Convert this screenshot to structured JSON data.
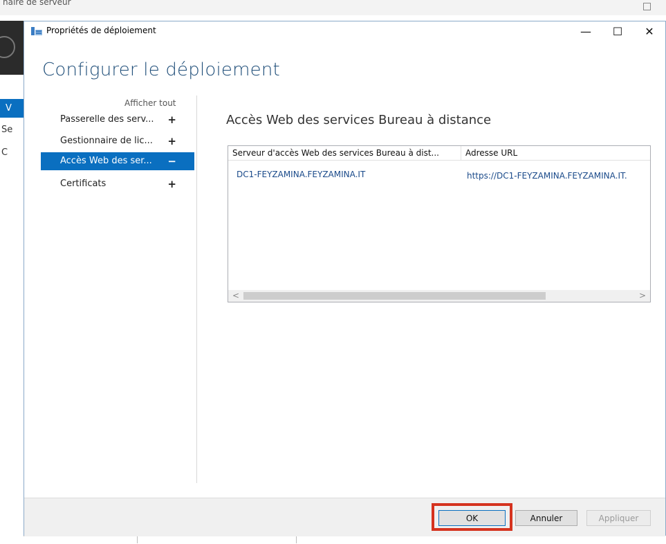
{
  "background": {
    "window_title": "naire de serveur",
    "side_selected": "V",
    "side_items": [
      "Se",
      "C"
    ]
  },
  "dialog": {
    "title": "Propriétés de déploiement",
    "window_controls": {
      "minimize": "—",
      "maximize": "☐",
      "close": "✕"
    },
    "heading": "Configurer le déploiement",
    "nav": {
      "show_all": "Afficher tout",
      "items": [
        {
          "label": "Passerelle des serv...",
          "toggle": "+"
        },
        {
          "label": "Gestionnaire de lic...",
          "toggle": "+"
        },
        {
          "label": "Accès Web des ser...",
          "toggle": "−",
          "selected": true
        },
        {
          "label": "Certificats",
          "toggle": "+"
        }
      ]
    },
    "section_title": "Accès Web des services Bureau à distance",
    "table": {
      "columns": [
        "Serveur d'accès Web des services Bureau à dist...",
        "Adresse URL"
      ],
      "rows": [
        [
          "DC1-FEYZAMINA.FEYZAMINA.IT",
          "https://DC1-FEYZAMINA.FEYZAMINA.IT."
        ]
      ],
      "scroll_left": "<",
      "scroll_right": ">"
    },
    "buttons": {
      "ok": "OK",
      "cancel": "Annuler",
      "apply": "Appliquer"
    }
  },
  "colors": {
    "accent": "#0a6fc0",
    "heading": "#1f4e79",
    "highlight": "#d5331f"
  }
}
